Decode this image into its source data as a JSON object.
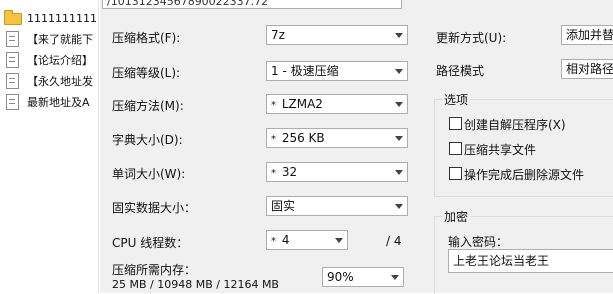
{
  "explorer": {
    "items": [
      {
        "label": "1111111111",
        "icon": "folder-icon"
      },
      {
        "label": "【来了就能下",
        "icon": "document-icon"
      },
      {
        "label": "【论坛介绍】",
        "icon": "document-icon"
      },
      {
        "label": "【永久地址发",
        "icon": "document-icon"
      },
      {
        "label": "最新地址及A",
        "icon": "document-icon"
      }
    ]
  },
  "dialog": {
    "archive_path": "/10131234567890022337.72",
    "compression_format": {
      "label": "压缩格式(F):",
      "value": "7z"
    },
    "compression_level": {
      "label": "压缩等级(L):",
      "value": "1 - 极速压缩"
    },
    "compression_method": {
      "label": "压缩方法(M):",
      "value": "LZMA2"
    },
    "dictionary_size": {
      "label": "字典大小(D):",
      "value": "256 KB"
    },
    "word_size": {
      "label": "单词大小(W):",
      "value": "32"
    },
    "solid_block_size": {
      "label": "固实数据大小：",
      "value": "固实"
    },
    "cpu_threads": {
      "label": "CPU 线程数：",
      "value": "4",
      "max": "/ 4"
    },
    "memory": {
      "label": "压缩所需内存：",
      "detail": "25 MB / 10948 MB / 12164 MB",
      "percent": "90%"
    },
    "update_mode": {
      "label": "更新方式(U):",
      "value": "添加并替"
    },
    "path_mode": {
      "label": "路径模式",
      "value": "相对路径"
    },
    "options": {
      "title": "选项",
      "items": [
        {
          "label": "创建自解压程序(X)",
          "checked": false
        },
        {
          "label": "压缩共享文件",
          "checked": false
        },
        {
          "label": "操作完成后删除源文件",
          "checked": false
        }
      ]
    },
    "encryption": {
      "title": "加密",
      "password_label": "输入密码：",
      "password_value": "上老王论坛当老王"
    },
    "star_glyph": "*"
  }
}
